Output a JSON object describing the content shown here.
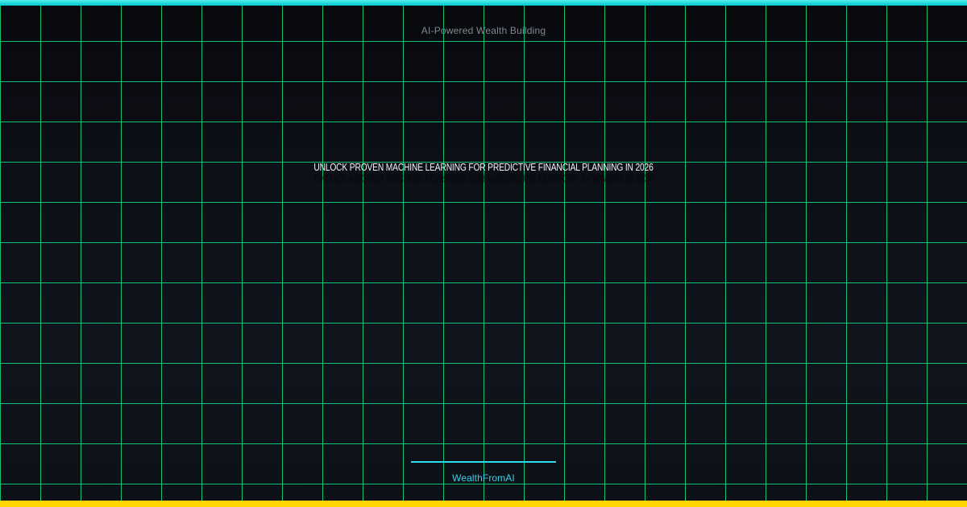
{
  "card": {
    "kicker": "AI-Powered Wealth Building",
    "headline": "UNLOCK PROVEN MACHINE LEARNING FOR PREDICTIVE FINANCIAL PLANNING IN 2026",
    "brand": "WealthFromAI"
  },
  "colors": {
    "top_bar_cyan": "#1fd9dc",
    "bottom_bar_gold": "#ffd400",
    "grid_line_green": "#13e087",
    "background_dark": "#0d0f15",
    "headline_white": "#f3f5f8",
    "kicker_gray": "#83878f",
    "brand_cyan": "#33d4ea",
    "divider_cyan": "#2bdcec"
  }
}
